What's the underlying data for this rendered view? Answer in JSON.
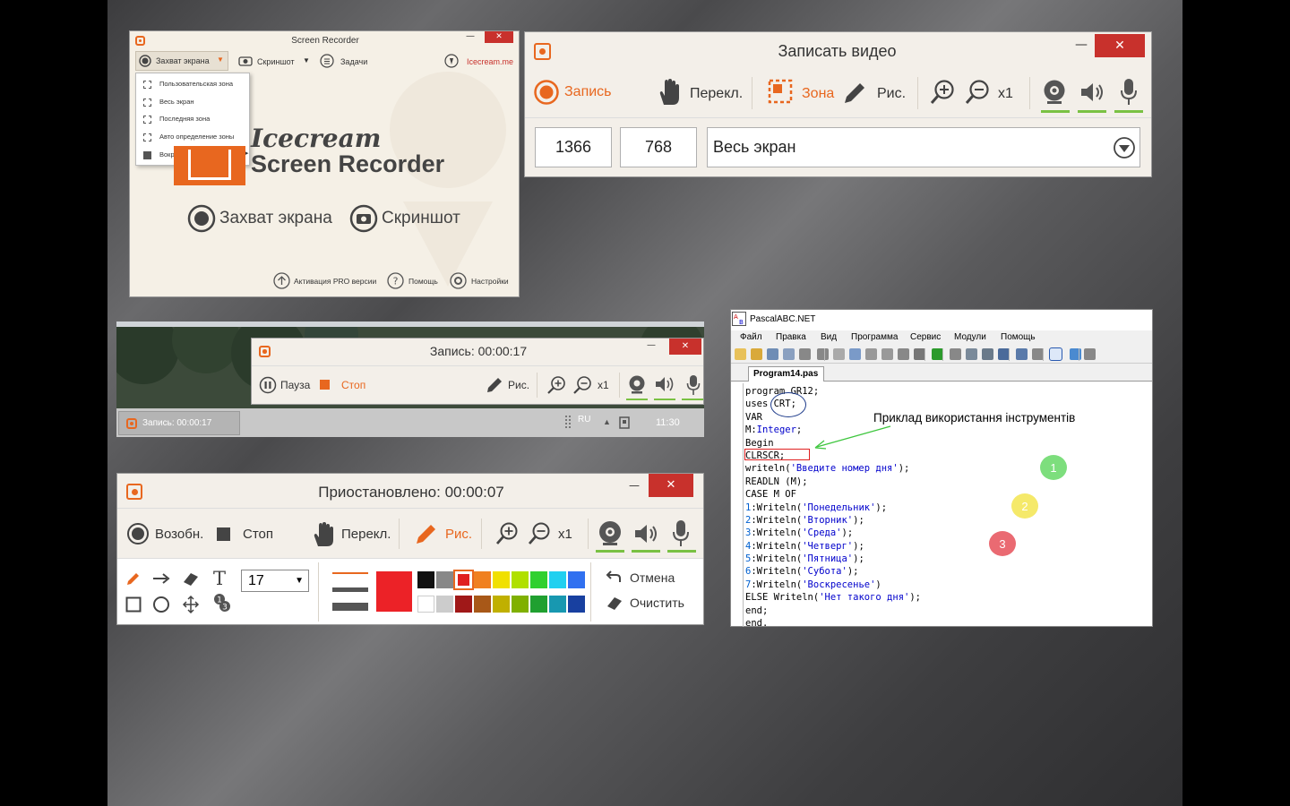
{
  "main_window": {
    "title": "Screen Recorder",
    "capture_label": "Захват экрана",
    "screenshot_label": "Скриншот",
    "tasks_label": "Задачи",
    "site_label": "Icecream.me",
    "dropdown": [
      "Пользовательская зона",
      "Весь экран",
      "Последняя зона",
      "Авто определение зоны",
      "Вокруг курсора"
    ],
    "brand_line1": "Icecream",
    "brand_line2": "Screen Recorder",
    "big_capture": "Захват экрана",
    "big_screenshot": "Скриншот",
    "footer": [
      "Активация PRO версии",
      "Помощь",
      "Настройки"
    ]
  },
  "record_window": {
    "title": "Записать видео",
    "record": "Запись",
    "switch": "Перекл.",
    "zone": "Зона",
    "draw": "Рис.",
    "zoom": "x1",
    "width": "1366",
    "height": "768",
    "area": "Весь экран"
  },
  "recording_window": {
    "title": "Запись:  00:00:17",
    "pause": "Пауза",
    "stop": "Стоп",
    "draw": "Рис.",
    "zoom": "x1",
    "taskbar_item": "Запись:  00:00:17",
    "lang": "RU",
    "clock": "11:30"
  },
  "paused_window": {
    "title": "Приостановлено: 00:00:07",
    "resume": "Возобн.",
    "stop": "Стоп",
    "switch": "Перекл.",
    "draw": "Рис.",
    "zoom": "x1",
    "size_value": "17",
    "undo": "Отмена",
    "clear": "Очистить",
    "palette_top": [
      "#111111",
      "#888888",
      "#e02020",
      "#f08020",
      "#f0e000",
      "#b0e000",
      "#30d030",
      "#20d0f0",
      "#3070f0"
    ],
    "palette_bottom": [
      "#ffffff",
      "#cccccc",
      "#a01818",
      "#a85818",
      "#c0b000",
      "#80b000",
      "#20a030",
      "#1898b0",
      "#1840a0"
    ],
    "accent": "#e8671f"
  },
  "pascal": {
    "title": "PascalABC.NET",
    "menu": [
      "Файл",
      "Правка",
      "Вид",
      "Программа",
      "Сервис",
      "Модули",
      "Помощь"
    ],
    "tab": "Program14.pas",
    "annotation": "Приклад використання інструментів",
    "badges": [
      "1",
      "2",
      "3"
    ],
    "code": [
      "program GR12;",
      "uses CRT;",
      "VAR",
      "M:Integer;",
      "Begin",
      "CLRSCR;",
      "writeln('Введите номер дня');",
      "READLN (M);",
      "CASE M OF",
      "1:Writeln('Понедельник');",
      "2:Writeln('Вторник');",
      "3:Writeln('Среда');",
      "4:Writeln('Четверг');",
      "5:Writeln('Пятница');",
      "6:Writeln('Субота');",
      "7:Writeln('Воскресенье')",
      "ELSE Writeln('Нет такого дня');",
      "end;",
      "end."
    ]
  }
}
